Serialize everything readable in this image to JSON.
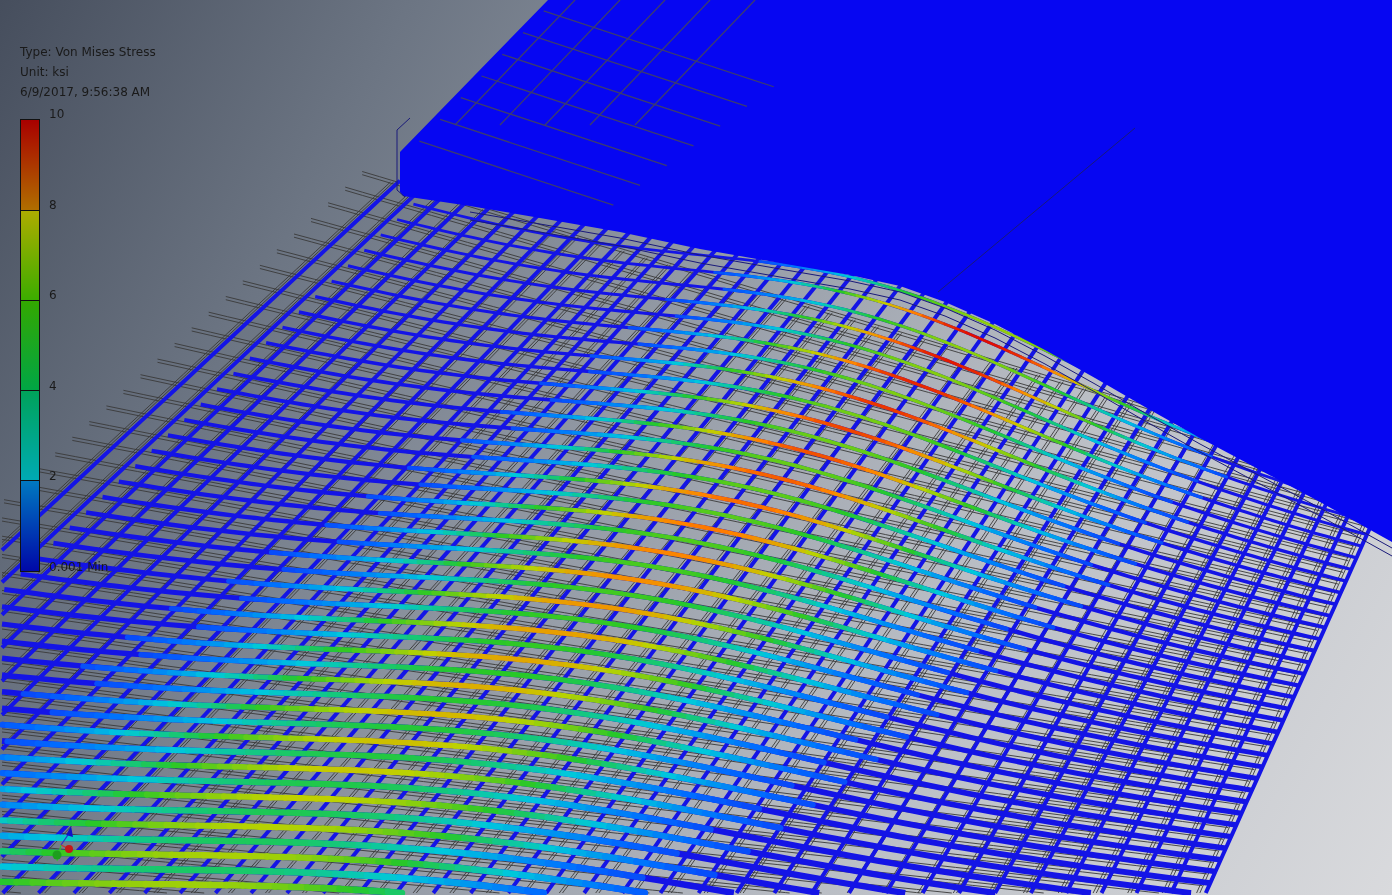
{
  "legend": {
    "type": "Type: Von Mises Stress",
    "unit": "Unit: ksi",
    "timestamp": "6/9/2017, 9:56:38 AM",
    "scale_labels": [
      "10",
      "8",
      "6",
      "4",
      "2",
      "0.001 Min"
    ]
  }
}
